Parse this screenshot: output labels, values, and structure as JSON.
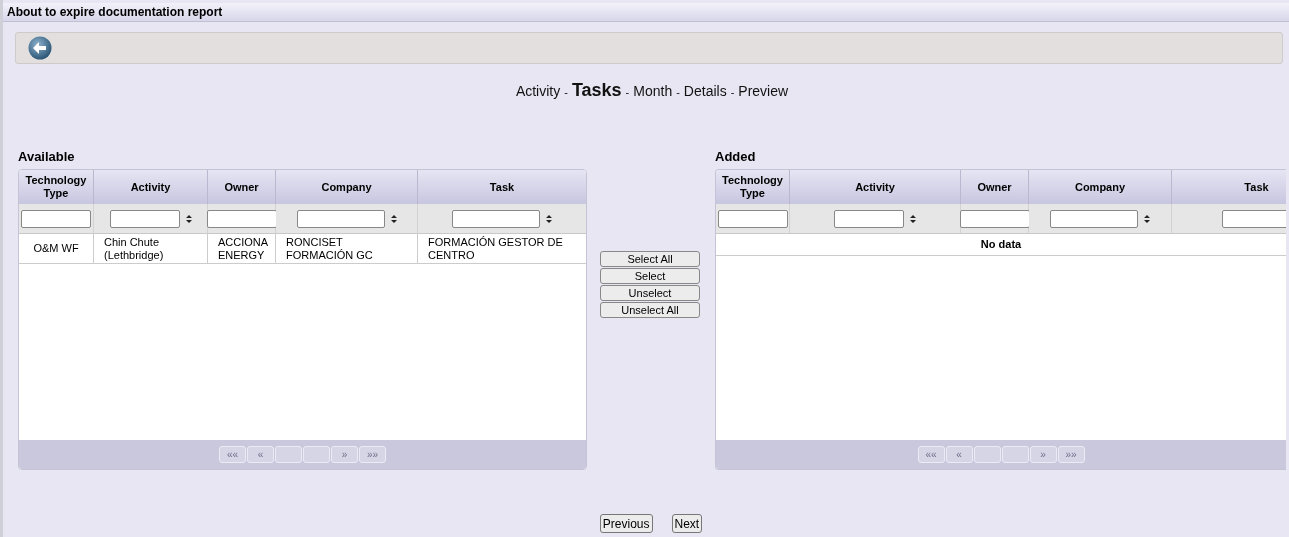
{
  "window": {
    "title": "About to expire documentation report"
  },
  "steps": [
    {
      "label": "Activity",
      "selected": false
    },
    {
      "label": "Tasks",
      "selected": true
    },
    {
      "label": "Month",
      "selected": false
    },
    {
      "label": "Details",
      "selected": false
    },
    {
      "label": "Preview",
      "selected": false
    }
  ],
  "step_separator": "-",
  "available": {
    "title": "Available",
    "columns": [
      {
        "label": "Technology Type",
        "sort_icon": false
      },
      {
        "label": "Activity",
        "sort_icon": true
      },
      {
        "label": "Owner",
        "sort_icon": false
      },
      {
        "label": "Company",
        "sort_icon": true
      },
      {
        "label": "Task",
        "sort_icon": true
      }
    ],
    "rows": [
      [
        "O&M WF",
        "Chin Chute (Lethbridge)",
        "ACCIONA ENERGY",
        "RONCISET FORMACIÓN GC",
        "FORMACIÓN GESTOR DE CENTRO"
      ]
    ],
    "pager": {
      "before": [
        "««",
        "«"
      ],
      "after": [
        "»",
        "»»"
      ]
    }
  },
  "transfer_buttons": [
    "Select All",
    "Select",
    "Unselect",
    "Unselect All"
  ],
  "added": {
    "title": "Added",
    "columns": [
      {
        "label": "Technology Type",
        "sort_icon": false
      },
      {
        "label": "Activity",
        "sort_icon": true
      },
      {
        "label": "Owner",
        "sort_icon": false
      },
      {
        "label": "Company",
        "sort_icon": true
      },
      {
        "label": "Task",
        "sort_icon": false
      }
    ],
    "empty_message": "No data",
    "pager": {
      "before": [
        "««",
        "«"
      ],
      "after": [
        "»",
        "»»"
      ]
    }
  },
  "nav_buttons": [
    "Previous",
    "Next"
  ]
}
